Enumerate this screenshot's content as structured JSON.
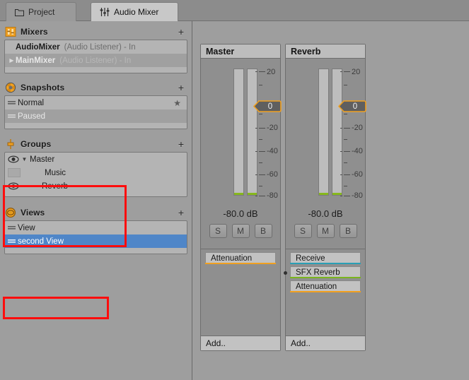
{
  "window": {
    "background": "#9e9e9e",
    "accent_orange": "#f0a020",
    "selection_blue": "#4f86c8"
  },
  "tabs": [
    {
      "id": "project",
      "label": "Project",
      "icon": "folder-icon",
      "active": false
    },
    {
      "id": "audio-mixer",
      "label": "Audio Mixer",
      "icon": "audio-mixer-icon",
      "active": true
    }
  ],
  "sidebar": {
    "sections": [
      {
        "id": "mixers",
        "title": "Mixers",
        "icon": "mixer-sliders-icon",
        "add_label": "+",
        "rows": [
          {
            "name": "AudioMixer",
            "detail": "(Audio Listener) - In",
            "selected": false,
            "expandable": false
          },
          {
            "name": "MainMixer",
            "detail": "(Audio Listener) - In",
            "selected": true,
            "expandable": true
          }
        ]
      },
      {
        "id": "snapshots",
        "title": "Snapshots",
        "icon": "aperture-icon",
        "add_label": "+",
        "rows": [
          {
            "name": "Normal",
            "selected": false,
            "starred": true
          },
          {
            "name": "Paused",
            "selected": true,
            "starred": false
          }
        ]
      },
      {
        "id": "groups",
        "title": "Groups",
        "icon": "fader-icon",
        "add_label": "+",
        "rows": [
          {
            "name": "Master",
            "visible": true,
            "expandable": true,
            "indent": false
          },
          {
            "name": "Music",
            "visible": false,
            "expandable": false,
            "indent": true
          },
          {
            "name": "Reverb",
            "visible": true,
            "expandable": false,
            "indent": true
          }
        ]
      },
      {
        "id": "views",
        "title": "Views",
        "icon": "eye-circle-icon",
        "add_label": "+",
        "rows": [
          {
            "name": "View",
            "selected": false
          },
          {
            "name": "second View",
            "selected": true
          }
        ]
      }
    ]
  },
  "mixer": {
    "scale": {
      "labels": [
        "20",
        "-20",
        "-40",
        "-60",
        "-80"
      ],
      "label_positions_pct": [
        2,
        46,
        64,
        82,
        99
      ],
      "major_ticks_pct": [
        2,
        46,
        64,
        82,
        99
      ],
      "minor_ticks_pct": [
        12,
        36,
        55,
        73,
        91
      ]
    },
    "strips": [
      {
        "id": "master",
        "title": "Master",
        "fader_value": "0",
        "fader_top_pct": 26,
        "db_readout": "-80.0 dB",
        "meter_levels_pct": [
          2,
          2
        ],
        "buttons": [
          {
            "id": "solo",
            "label": "S"
          },
          {
            "id": "mute",
            "label": "M"
          },
          {
            "id": "bypass",
            "label": "B"
          }
        ],
        "effects": [
          {
            "name": "Attenuation",
            "color": "#f0a020",
            "selected": false
          }
        ],
        "add_label": "Add.."
      },
      {
        "id": "reverb",
        "title": "Reverb",
        "fader_value": "0",
        "fader_top_pct": 26,
        "db_readout": "-80.0 dB",
        "meter_levels_pct": [
          2,
          2
        ],
        "buttons": [
          {
            "id": "solo",
            "label": "S"
          },
          {
            "id": "mute",
            "label": "M"
          },
          {
            "id": "bypass",
            "label": "B"
          }
        ],
        "effects": [
          {
            "name": "Receive",
            "color": "#2a9fb5",
            "selected": false
          },
          {
            "name": "SFX Reverb",
            "color": "#7ab51e",
            "selected": true
          },
          {
            "name": "Attenuation",
            "color": "#f0a020",
            "selected": false
          }
        ],
        "add_label": "Add.."
      }
    ]
  },
  "annotations": [
    {
      "id": "groups-highlight",
      "color": "#ff0d0d"
    },
    {
      "id": "views-highlight",
      "color": "#ff0d0d"
    }
  ]
}
